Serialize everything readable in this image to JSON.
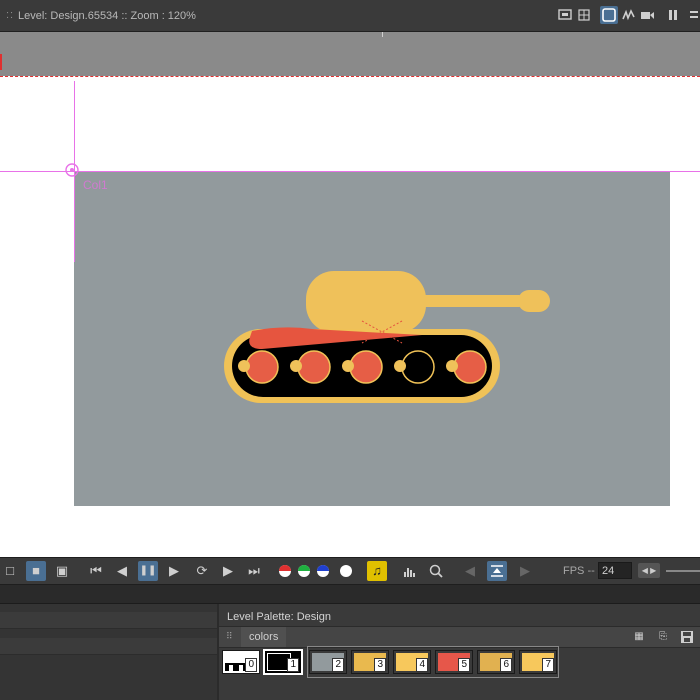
{
  "topbar": {
    "title": "Level: Design.65534  ::  Zoom : 120%",
    "buttons": [
      {
        "name": "preview-toggle",
        "icon": "monitor-icon"
      },
      {
        "name": "grid-toggle",
        "icon": "grid-icon"
      },
      {
        "name": "camera-stand-toggle",
        "icon": "frame-icon",
        "active": true
      },
      {
        "name": "sub-camera-toggle",
        "icon": "freehand-icon"
      },
      {
        "name": "camera-view-toggle",
        "icon": "camera-icon"
      },
      {
        "name": "pause-toggle",
        "icon": "pause-icon"
      }
    ]
  },
  "viewer": {
    "column_label": "Col1",
    "stage_color": "#929a9d"
  },
  "playback": {
    "fps_label": "FPS -- /",
    "fps_value": "24",
    "buttons": [
      {
        "name": "view-white-bg",
        "glyph": "□"
      },
      {
        "name": "view-black-bg",
        "glyph": "■",
        "active": true
      },
      {
        "name": "view-checker-bg",
        "glyph": "▣"
      },
      {
        "name": "first-frame",
        "glyph": "⏮"
      },
      {
        "name": "prev-frame",
        "glyph": "◀"
      },
      {
        "name": "pause",
        "glyph": "❚❚",
        "active": true
      },
      {
        "name": "play",
        "glyph": "▶"
      },
      {
        "name": "loop",
        "glyph": "⟳"
      },
      {
        "name": "next-frame",
        "glyph": "▶"
      },
      {
        "name": "last-frame",
        "glyph": "⏭"
      },
      {
        "name": "red-channel",
        "glyph": "●"
      },
      {
        "name": "green-channel",
        "glyph": "●"
      },
      {
        "name": "blue-channel",
        "glyph": "●"
      },
      {
        "name": "alpha-channel",
        "glyph": "●"
      },
      {
        "name": "sound-toggle",
        "glyph": "♫",
        "yellow": true
      },
      {
        "name": "histogram",
        "glyph": "▟"
      },
      {
        "name": "zoom",
        "glyph": "⌕"
      },
      {
        "name": "prev-marker",
        "glyph": "◀"
      },
      {
        "name": "sync-marker",
        "glyph": "⌖",
        "active": true
      },
      {
        "name": "next-marker",
        "glyph": "▶"
      }
    ]
  },
  "palette": {
    "title": "Level Palette: Design",
    "tab": "colors",
    "tools": [
      "list-view-icon",
      "save-as-icon",
      "save-icon"
    ],
    "styles": [
      {
        "index": "0",
        "color": "#ffffff"
      },
      {
        "index": "1",
        "color": "#000000",
        "selected": true
      },
      {
        "index": "2",
        "color": "#929a9d"
      },
      {
        "index": "3",
        "color": "#e9b94e"
      },
      {
        "index": "4",
        "color": "#f7c85c"
      },
      {
        "index": "5",
        "color": "#e6574a"
      },
      {
        "index": "6",
        "color": "#e1b150"
      },
      {
        "index": "7",
        "color": "#f7c85c"
      }
    ]
  },
  "colors": {
    "tank_body": "#efc15a",
    "tank_outline": "#f0c257",
    "tank_track": "#000000",
    "wheel": "#e65e46",
    "accent_red": "#e6553f",
    "guide": "#e872e8"
  }
}
